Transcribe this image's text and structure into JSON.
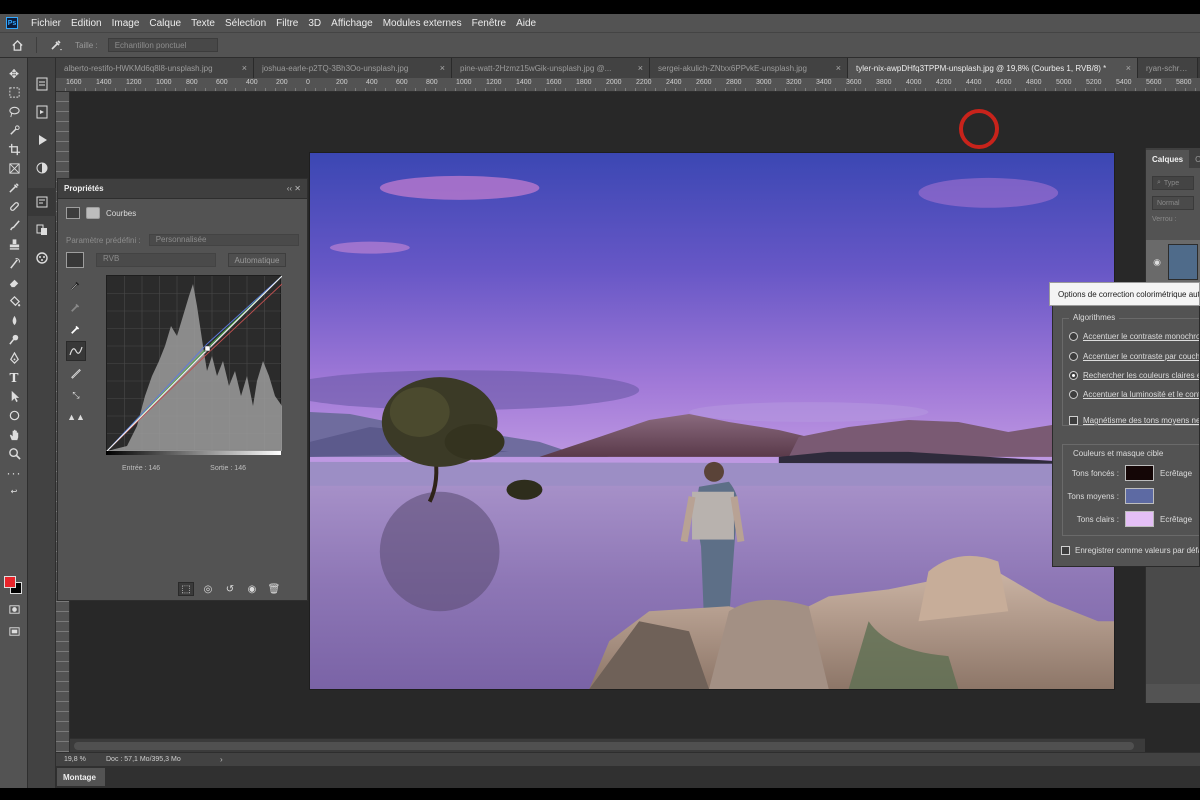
{
  "app": {
    "logo": "Ps"
  },
  "menu": [
    "Fichier",
    "Edition",
    "Image",
    "Calque",
    "Texte",
    "Sélection",
    "Filtre",
    "3D",
    "Affichage",
    "Modules externes",
    "Fenêtre",
    "Aide"
  ],
  "options_bar": {
    "size_label": "Taille :",
    "sample_select": "Echantillon ponctuel"
  },
  "tabs": [
    {
      "label": "alberto-restifo-HWKMd6q8l8-unsplash.jpg",
      "active": false
    },
    {
      "label": "joshua-earle-p2TQ-3Bh3Oo-unsplash.jpg",
      "active": false
    },
    {
      "label": "pine-watt-2Hzmz15wGik-unsplash.jpg @...",
      "active": false
    },
    {
      "label": "sergei-akulich-ZNtxx6PPvkE-unsplash.jpg",
      "active": false
    },
    {
      "label": "tyler-nix-awpDHfq3TPPM-unsplash.jpg @ 19,8% (Courbes 1, RVB/8) *",
      "active": true
    },
    {
      "label": "ryan-schroede",
      "active": false
    }
  ],
  "ruler_top": [
    "1600",
    "1400",
    "1200",
    "1000",
    "800",
    "600",
    "400",
    "200",
    "0",
    "200",
    "400",
    "600",
    "800",
    "1000",
    "1200",
    "1400",
    "1600",
    "1800",
    "2000",
    "2200",
    "2400",
    "2600",
    "2800",
    "3000",
    "3200",
    "3400",
    "3600",
    "3800",
    "4000",
    "4200",
    "4400",
    "4600",
    "4800",
    "5000",
    "5200",
    "5400",
    "5600",
    "5800"
  ],
  "properties": {
    "title": "Propriétés",
    "type_label": "Courbes",
    "preset_label": "Paramètre prédéfini :",
    "preset_value": "Personnalisée",
    "channel_value": "RVB",
    "auto_button": "Automatique",
    "input_label": "Entrée :",
    "input_value": "146",
    "output_label": "Sortie :",
    "output_value": "146"
  },
  "layers_panel": {
    "tab_layers": "Calques",
    "tab_other": "Ca",
    "search_placeholder": "Type",
    "blend_mode": "Normal",
    "lock_label": "Verrou :"
  },
  "tooltip": {
    "text": "Options de correction colorimétrique automatique"
  },
  "auto_color_dialog": {
    "algorithms_legend": "Algorithmes",
    "algorithms": [
      {
        "label": "Accentuer le contraste monochromatique",
        "checked": false
      },
      {
        "label": "Accentuer le contraste par couches",
        "checked": false
      },
      {
        "label": "Rechercher les couleurs claires et foncées",
        "checked": true
      },
      {
        "label": "Accentuer la luminosité et le contraste",
        "checked": false
      }
    ],
    "snap_neutral_label": "Magnétisme des tons moyens neutres",
    "target_legend": "Couleurs et masque cible",
    "targets": [
      {
        "label": "Tons foncés :",
        "color": "#140606",
        "clip_label": "Ecrêtage"
      },
      {
        "label": "Tons moyens :",
        "color": "#5d6aa3",
        "clip_label": ""
      },
      {
        "label": "Tons clairs :",
        "color": "#e4bff6",
        "clip_label": "Ecrêtage"
      }
    ],
    "save_defaults_label": "Enregistrer comme valeurs par défaut"
  },
  "status": {
    "zoom": "19,8 %",
    "doc": "Doc : 57,1 Mo/395,3 Mo"
  },
  "bottom_tab": "Montage"
}
